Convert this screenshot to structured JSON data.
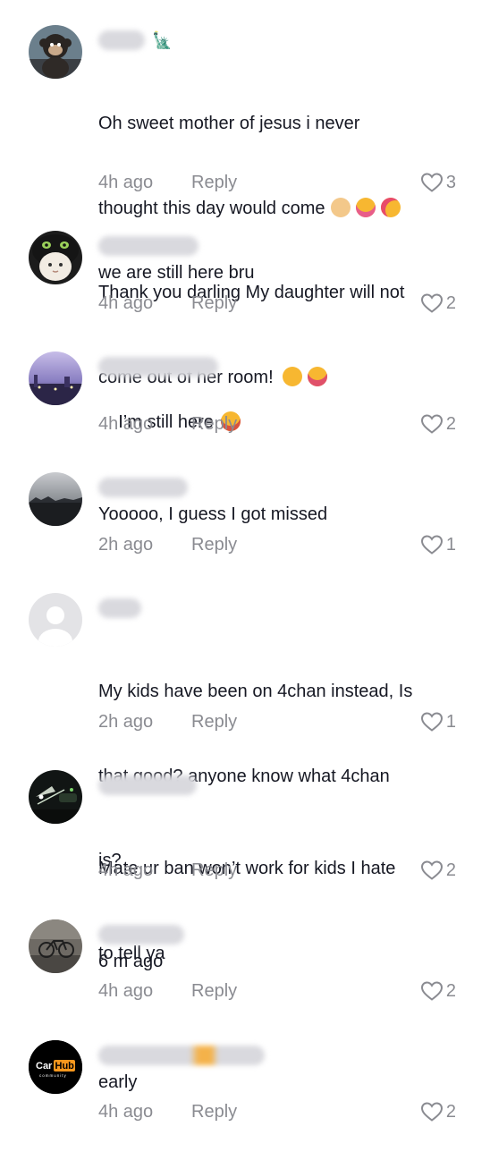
{
  "comments": [
    {
      "id": "c1",
      "avatar_icon": "monkey-toy-avatar",
      "username_hidden": true,
      "badge": "🗽",
      "text_lines": [
        "Oh sweet mother of jesus i never",
        "thought this day would come",
        "Thank you darling My daughter will not",
        "come out of her room!"
      ],
      "emojis_line2": [
        "clapping-hands",
        "partying-face",
        "smiling-face-with-hearts"
      ],
      "emojis_line4": [
        "disappointed-face",
        "tongue-face"
      ],
      "time": "4h ago",
      "reply": "Reply",
      "likes": "3"
    },
    {
      "id": "c2",
      "avatar_icon": "cat-in-dragon-hood-avatar",
      "username_hidden": true,
      "text": "we are still here bru",
      "time": "4h ago",
      "reply": "Reply",
      "likes": "2"
    },
    {
      "id": "c3",
      "avatar_icon": "purple-night-city-avatar",
      "username_hidden": true,
      "text": "I’m still here",
      "emoji": "laughing-crying-face",
      "time": "4h ago",
      "reply": "Reply",
      "likes": "2"
    },
    {
      "id": "c4",
      "avatar_icon": "dusk-landscape-avatar",
      "username_hidden": true,
      "text": "Yooooo, I guess I got missed",
      "time": "2h ago",
      "reply": "Reply",
      "likes": "1"
    },
    {
      "id": "c5",
      "avatar_icon": "default-person-avatar",
      "username_hidden": true,
      "text_lines": [
        "My kids have been on 4chan instead, Is",
        "that good? anyone know what 4chan",
        "is?"
      ],
      "time": "2h ago",
      "reply": "Reply",
      "likes": "1"
    },
    {
      "id": "c6",
      "avatar_icon": "night-car-lights-avatar",
      "username_hidden": true,
      "text_lines": [
        "Mate ur ban won’t work for kids I hate",
        "to tell ya"
      ],
      "time": "4h ago",
      "reply": "Reply",
      "likes": "2"
    },
    {
      "id": "c7",
      "avatar_icon": "bicycle-photo-avatar",
      "username_hidden": true,
      "text": "6 m ago",
      "time": "4h ago",
      "reply": "Reply",
      "likes": "2"
    },
    {
      "id": "c8",
      "avatar_icon": "carhub-logo-avatar",
      "avatar_logo_text": "CarHub",
      "avatar_logo_sub": "community",
      "username_hidden": true,
      "text": "early",
      "time": "4h ago",
      "reply": "Reply",
      "likes": "2"
    }
  ],
  "colors": {
    "text": "#161823",
    "muted": "#8a8b91",
    "background": "#ffffff"
  }
}
